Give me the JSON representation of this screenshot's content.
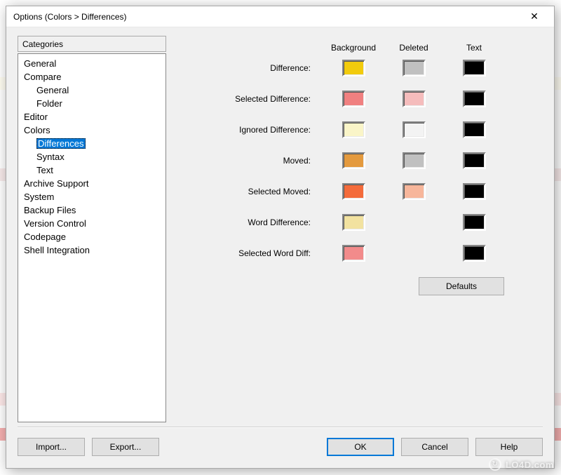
{
  "window": {
    "title": "Options (Colors > Differences)"
  },
  "categories": {
    "header": "Categories",
    "items": [
      {
        "label": "General",
        "indent": 0
      },
      {
        "label": "Compare",
        "indent": 0
      },
      {
        "label": "General",
        "indent": 1
      },
      {
        "label": "Folder",
        "indent": 1
      },
      {
        "label": "Editor",
        "indent": 0
      },
      {
        "label": "Colors",
        "indent": 0
      },
      {
        "label": "Differences",
        "indent": 1,
        "selected": true
      },
      {
        "label": "Syntax",
        "indent": 1
      },
      {
        "label": "Text",
        "indent": 1
      },
      {
        "label": "Archive Support",
        "indent": 0
      },
      {
        "label": "System",
        "indent": 0
      },
      {
        "label": "Backup Files",
        "indent": 0
      },
      {
        "label": "Version Control",
        "indent": 0
      },
      {
        "label": "Codepage",
        "indent": 0
      },
      {
        "label": "Shell Integration",
        "indent": 0
      }
    ]
  },
  "columns": {
    "background": "Background",
    "deleted": "Deleted",
    "text": "Text"
  },
  "rows": [
    {
      "label": "Difference:",
      "bg": "#F2CB0D",
      "del": "#C0C0C0",
      "text": "#000000"
    },
    {
      "label": "Selected Difference:",
      "bg": "#F08080",
      "del": "#F5BCBC",
      "text": "#000000"
    },
    {
      "label": "Ignored Difference:",
      "bg": "#FAF5C8",
      "del": "#F3F3F3",
      "text": "#000000"
    },
    {
      "label": "Moved:",
      "bg": "#E49A3E",
      "del": "#C0C0C0",
      "text": "#000000"
    },
    {
      "label": "Selected Moved:",
      "bg": "#F46B3B",
      "del": "#F7B69B",
      "text": "#000000"
    },
    {
      "label": "Word Difference:",
      "bg": "#F2E2A0",
      "del": null,
      "text": "#000000"
    },
    {
      "label": "Selected Word Diff:",
      "bg": "#F28B8B",
      "del": null,
      "text": "#000000"
    }
  ],
  "buttons": {
    "defaults": "Defaults",
    "import": "Import...",
    "export": "Export...",
    "ok": "OK",
    "cancel": "Cancel",
    "help": "Help"
  },
  "watermark": "LO4D.com"
}
